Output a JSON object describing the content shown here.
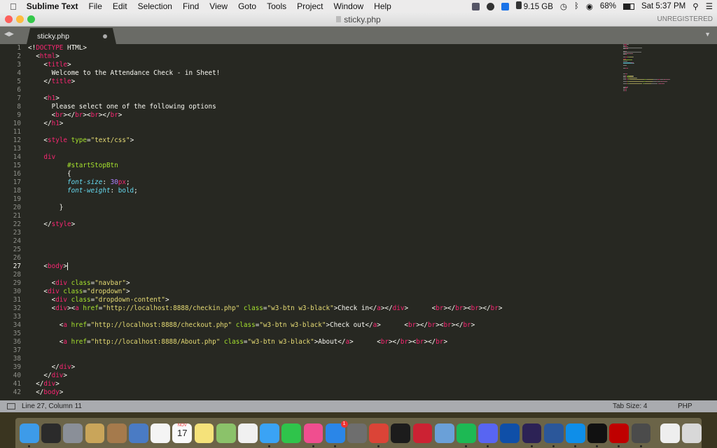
{
  "menubar": {
    "apple": "",
    "app": "Sublime Text",
    "items": [
      "File",
      "Edit",
      "Selection",
      "Find",
      "View",
      "Goto",
      "Tools",
      "Project",
      "Window",
      "Help"
    ],
    "disk": "9.15 GB",
    "battery": "68%",
    "clock": "Sat 5:37 PM"
  },
  "window": {
    "title": "sticky.php",
    "unregistered": "UNREGISTERED"
  },
  "tab": {
    "label": "sticky.php"
  },
  "editor": {
    "current_line": 27,
    "lines": [
      [
        [
          "p",
          "<!"
        ],
        [
          "t",
          "DOCTYPE"
        ],
        [
          "x",
          " HTML>"
        ]
      ],
      [
        [
          "x",
          "  <"
        ],
        [
          "t",
          "html"
        ],
        [
          "x",
          ">"
        ]
      ],
      [
        [
          "x",
          "    <"
        ],
        [
          "t",
          "title"
        ],
        [
          "x",
          ">"
        ]
      ],
      [
        [
          "x",
          "      Welcome to the Attendance Check - in Sheet!"
        ]
      ],
      [
        [
          "x",
          "    </"
        ],
        [
          "t",
          "title"
        ],
        [
          "x",
          ">"
        ]
      ],
      [],
      [
        [
          "x",
          "    <"
        ],
        [
          "t",
          "h1"
        ],
        [
          "x",
          ">"
        ]
      ],
      [
        [
          "x",
          "      Please select one of the following options"
        ]
      ],
      [
        [
          "x",
          "      <"
        ],
        [
          "t",
          "br"
        ],
        [
          "x",
          "></"
        ],
        [
          "t",
          "br"
        ],
        [
          "x",
          "><"
        ],
        [
          "t",
          "br"
        ],
        [
          "x",
          "></"
        ],
        [
          "t",
          "br"
        ],
        [
          "x",
          ">"
        ]
      ],
      [
        [
          "x",
          "    </"
        ],
        [
          "t",
          "h1"
        ],
        [
          "x",
          ">"
        ]
      ],
      [],
      [
        [
          "x",
          "    <"
        ],
        [
          "t",
          "style"
        ],
        [
          "x",
          " "
        ],
        [
          "a",
          "type"
        ],
        [
          "x",
          "="
        ],
        [
          "s",
          "\"text/css\""
        ],
        [
          "x",
          ">"
        ]
      ],
      [],
      [
        [
          "t",
          "    div"
        ]
      ],
      [
        [
          "c",
          "          #startStopBtn"
        ]
      ],
      [
        [
          "x",
          "          {"
        ]
      ],
      [
        [
          "i",
          "          font-size"
        ],
        [
          "x",
          ": "
        ],
        [
          "n",
          "30"
        ],
        [
          "t",
          "px"
        ],
        [
          "x",
          ";"
        ]
      ],
      [
        [
          "i",
          "          font-weight"
        ],
        [
          "x",
          ": "
        ],
        [
          "k",
          "bold"
        ],
        [
          "x",
          ";"
        ]
      ],
      [],
      [
        [
          "x",
          "        }"
        ]
      ],
      [],
      [
        [
          "x",
          "    </"
        ],
        [
          "t",
          "style"
        ],
        [
          "x",
          ">"
        ]
      ],
      [],
      [],
      [],
      [],
      [
        [
          "x",
          "    <"
        ],
        [
          "t",
          "body"
        ],
        [
          "x",
          ">"
        ]
      ],
      [],
      [
        [
          "x",
          "      <"
        ],
        [
          "t",
          "div"
        ],
        [
          "x",
          " "
        ],
        [
          "a",
          "class"
        ],
        [
          "x",
          "="
        ],
        [
          "s",
          "\"navbar\""
        ],
        [
          "x",
          ">"
        ]
      ],
      [
        [
          "x",
          "    <"
        ],
        [
          "t",
          "div"
        ],
        [
          "x",
          " "
        ],
        [
          "a",
          "class"
        ],
        [
          "x",
          "="
        ],
        [
          "s",
          "\"dropdown\""
        ],
        [
          "x",
          ">"
        ]
      ],
      [
        [
          "x",
          "      <"
        ],
        [
          "t",
          "div"
        ],
        [
          "x",
          " "
        ],
        [
          "a",
          "class"
        ],
        [
          "x",
          "="
        ],
        [
          "s",
          "\"dropdown-content\""
        ],
        [
          "x",
          ">"
        ]
      ],
      [
        [
          "x",
          "      <"
        ],
        [
          "t",
          "div"
        ],
        [
          "x",
          "><"
        ],
        [
          "t",
          "a"
        ],
        [
          "x",
          " "
        ],
        [
          "a",
          "href"
        ],
        [
          "x",
          "="
        ],
        [
          "s",
          "\"http://localhost:8888/checkin.php\""
        ],
        [
          "x",
          " "
        ],
        [
          "a",
          "class"
        ],
        [
          "x",
          "="
        ],
        [
          "s",
          "\"w3-btn w3-black\""
        ],
        [
          "x",
          ">Check in</"
        ],
        [
          "t",
          "a"
        ],
        [
          "x",
          "></"
        ],
        [
          "t",
          "div"
        ],
        [
          "x",
          ">      <"
        ],
        [
          "t",
          "br"
        ],
        [
          "x",
          "></"
        ],
        [
          "t",
          "br"
        ],
        [
          "x",
          "><"
        ],
        [
          "t",
          "br"
        ],
        [
          "x",
          "></"
        ],
        [
          "t",
          "br"
        ],
        [
          "x",
          ">"
        ]
      ],
      [],
      [
        [
          "x",
          "        <"
        ],
        [
          "t",
          "a"
        ],
        [
          "x",
          " "
        ],
        [
          "a",
          "href"
        ],
        [
          "x",
          "="
        ],
        [
          "s",
          "\"http://localhost:8888/checkout.php\""
        ],
        [
          "x",
          " "
        ],
        [
          "a",
          "class"
        ],
        [
          "x",
          "="
        ],
        [
          "s",
          "\"w3-btn w3-black\""
        ],
        [
          "x",
          ">Check out</"
        ],
        [
          "t",
          "a"
        ],
        [
          "x",
          ">      <"
        ],
        [
          "t",
          "br"
        ],
        [
          "x",
          "></"
        ],
        [
          "t",
          "br"
        ],
        [
          "x",
          "><"
        ],
        [
          "t",
          "br"
        ],
        [
          "x",
          "></"
        ],
        [
          "t",
          "br"
        ],
        [
          "x",
          ">"
        ]
      ],
      [],
      [
        [
          "x",
          "        <"
        ],
        [
          "t",
          "a"
        ],
        [
          "x",
          " "
        ],
        [
          "a",
          "href"
        ],
        [
          "x",
          "="
        ],
        [
          "s",
          "\"http://localhost:8888/About.php\""
        ],
        [
          "x",
          " "
        ],
        [
          "a",
          "class"
        ],
        [
          "x",
          "="
        ],
        [
          "s",
          "\"w3-btn w3-black\""
        ],
        [
          "x",
          ">About</"
        ],
        [
          "t",
          "a"
        ],
        [
          "x",
          ">      <"
        ],
        [
          "t",
          "br"
        ],
        [
          "x",
          "></"
        ],
        [
          "t",
          "br"
        ],
        [
          "x",
          "><"
        ],
        [
          "t",
          "br"
        ],
        [
          "x",
          "></"
        ],
        [
          "t",
          "br"
        ],
        [
          "x",
          ">"
        ]
      ],
      [],
      [],
      [
        [
          "x",
          "      </"
        ],
        [
          "t",
          "div"
        ],
        [
          "x",
          ">"
        ]
      ],
      [
        [
          "x",
          "    </"
        ],
        [
          "t",
          "div"
        ],
        [
          "x",
          ">"
        ]
      ],
      [
        [
          "x",
          "  </"
        ],
        [
          "t",
          "div"
        ],
        [
          "x",
          ">"
        ]
      ],
      [
        [
          "x",
          "  </"
        ],
        [
          "t",
          "body"
        ],
        [
          "x",
          ">"
        ]
      ]
    ]
  },
  "statusbar": {
    "position": "Line 27, Column 11",
    "tab_size": "Tab Size: 4",
    "syntax": "PHP"
  },
  "dock": {
    "badge": "1",
    "calendar_month": "NOV",
    "calendar_day": "17",
    "items": [
      {
        "name": "finder",
        "color": "#3d9be9",
        "running": true
      },
      {
        "name": "mission-control",
        "color": "#2b2b2b"
      },
      {
        "name": "launchpad",
        "color": "#8a8f98"
      },
      {
        "name": "utilities",
        "color": "#c9a55a"
      },
      {
        "name": "contacts",
        "color": "#a57a4c"
      },
      {
        "name": "preview",
        "color": "#4a7bc4"
      },
      {
        "name": "reminders",
        "color": "#f4f4f4"
      },
      {
        "name": "calendar",
        "color": "#fafafa"
      },
      {
        "name": "notes",
        "color": "#f5e27a"
      },
      {
        "name": "maps",
        "color": "#8bc26a"
      },
      {
        "name": "photos",
        "color": "#f0f0f0"
      },
      {
        "name": "messages",
        "color": "#3aa3f5",
        "running": true
      },
      {
        "name": "facetime",
        "color": "#2fc44b"
      },
      {
        "name": "itunes",
        "color": "#f04e8f",
        "running": true
      },
      {
        "name": "app-store",
        "color": "#2a86e8",
        "running": true
      },
      {
        "name": "system-preferences",
        "color": "#6e6e6e"
      },
      {
        "name": "chrome",
        "color": "#db4437",
        "running": true
      },
      {
        "name": "terminal",
        "color": "#1c1c1c"
      },
      {
        "name": "simulator",
        "color": "#c23"
      },
      {
        "name": "network-utility",
        "color": "#6aa0d8"
      },
      {
        "name": "spotify",
        "color": "#1db954",
        "running": true
      },
      {
        "name": "discord",
        "color": "#5865f2",
        "running": true
      },
      {
        "name": "ps4-remote-play",
        "color": "#0f4fa8"
      },
      {
        "name": "eclipse",
        "color": "#2c2255",
        "running": true
      },
      {
        "name": "word",
        "color": "#2b579a",
        "running": true
      },
      {
        "name": "teamviewer",
        "color": "#0e8ee9",
        "running": true
      },
      {
        "name": "server-app",
        "color": "#111",
        "running": true
      },
      {
        "name": "filezilla",
        "color": "#bf0000",
        "running": true
      },
      {
        "name": "sublime-text",
        "color": "#4b4b4b",
        "running": true
      },
      {
        "name": "document-stack",
        "color": "#eee"
      },
      {
        "name": "trash",
        "color": "#d8d8d8"
      }
    ]
  }
}
